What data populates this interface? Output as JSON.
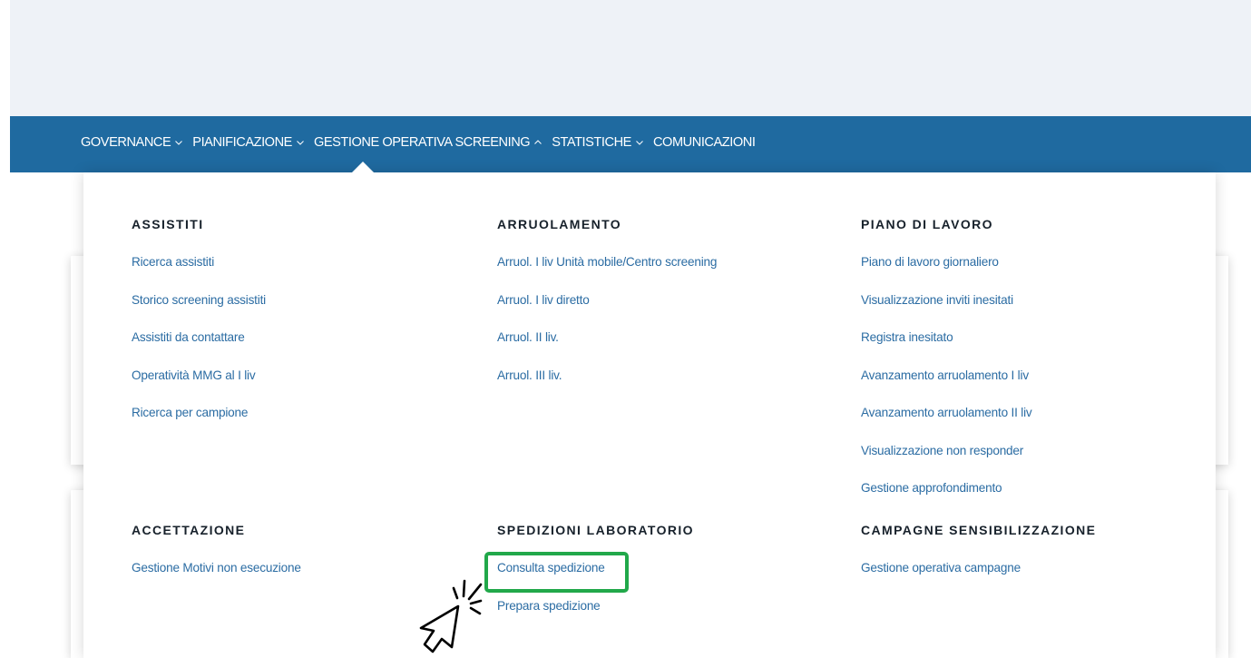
{
  "nav": {
    "items": [
      {
        "label": "GOVERNANCE",
        "icon": "chevron-down-icon"
      },
      {
        "label": "PIANIFICAZIONE",
        "icon": "chevron-down-icon"
      },
      {
        "label": "GESTIONE OPERATIVA SCREENING",
        "icon": "chevron-up-icon"
      },
      {
        "label": "STATISTICHE",
        "icon": "chevron-down-icon"
      },
      {
        "label": "COMUNICAZIONI",
        "icon": ""
      }
    ]
  },
  "mega_menu": {
    "assistiti": {
      "title": "ASSISTITI",
      "links": [
        "Ricerca assistiti",
        "Storico screening assistiti",
        "Assistiti da contattare",
        "Operatività MMG al I liv",
        "Ricerca per campione"
      ]
    },
    "arruolamento": {
      "title": "ARRUOLAMENTO",
      "links": [
        "Arruol. I liv Unità mobile/Centro screening",
        "Arruol. I liv diretto",
        "Arruol. II liv.",
        "Arruol. III liv."
      ]
    },
    "piano_lavoro": {
      "title": "PIANO DI LAVORO",
      "links": [
        "Piano di lavoro giornaliero",
        "Visualizzazione inviti inesitati",
        "Registra inesitato",
        "Avanzamento arruolamento I liv",
        "Avanzamento arruolamento II liv",
        "Visualizzazione non responder",
        "Gestione approfondimento"
      ]
    },
    "accettazione": {
      "title": "ACCETTAZIONE",
      "links": [
        "Gestione Motivi non esecuzione"
      ]
    },
    "spedizioni": {
      "title": "SPEDIZIONI LABORATORIO",
      "links": [
        "Consulta spedizione",
        "Prepara spedizione"
      ]
    },
    "campagne": {
      "title": "CAMPAGNE SENSIBILIZZAZIONE",
      "links": [
        "Gestione operativa campagne"
      ]
    }
  },
  "colors": {
    "navbar": "#1f6aa0",
    "link": "#2b6ca3",
    "highlight": "#21a84a"
  },
  "annotation": {
    "highlighted_link": "Consulta spedizione",
    "pointer_icon": "click-cursor-icon"
  }
}
